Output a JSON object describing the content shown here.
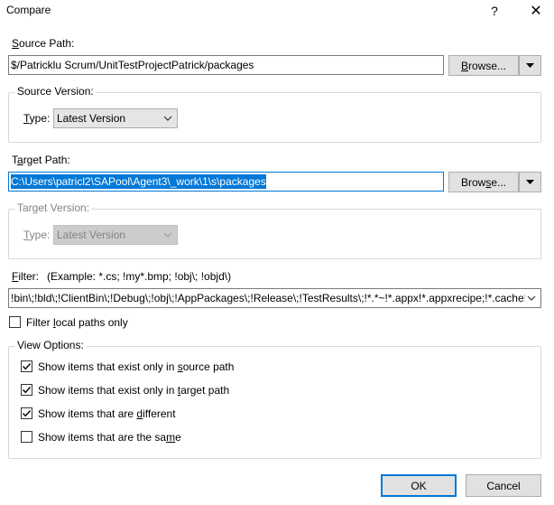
{
  "window": {
    "title": "Compare",
    "help_glyph": "?",
    "close_glyph": "✕"
  },
  "source": {
    "path_label_prefix": "",
    "path_label_mn": "S",
    "path_label_rest": "ource Path:",
    "path_value": "$/Patricklu Scrum/UnitTestProjectPatrick/packages",
    "browse_label_mn": "B",
    "browse_label_rest": "rowse..."
  },
  "source_version": {
    "group_title": "Source Version:",
    "type_label_mn": "T",
    "type_label_rest": "ype:",
    "type_value": "Latest Version"
  },
  "target": {
    "path_label_prefix": "T",
    "path_label_mn": "a",
    "path_label_rest": "rget Path:",
    "path_value": "C:\\Users\\patricl2\\SAPool\\Agent3\\_work\\1\\s\\packages",
    "browse_label_prefix": "Brow",
    "browse_label_mn": "s",
    "browse_label_rest": "e..."
  },
  "target_version": {
    "group_title": "Target Version:",
    "type_label_mn": "T",
    "type_label_rest": "ype:",
    "type_value": "Latest Version"
  },
  "filter": {
    "label_mn": "F",
    "label_rest": "ilter:",
    "example": "(Example: *.cs; !my*.bmp; !obj\\; !objd\\)",
    "value": "!bin\\;!bld\\;!ClientBin\\;!Debug\\;!obj\\;!AppPackages\\;!Release\\;!TestResults\\;!*.*~!*.appx!*.appxrecipe;!*.cache!",
    "local_only_prefix": "Filter ",
    "local_only_mn": "l",
    "local_only_rest": "ocal paths only",
    "local_only_checked": false
  },
  "view_options": {
    "group_title": "View Options:",
    "items": [
      {
        "prefix": "Show items that exist only in ",
        "mn": "s",
        "rest": "ource path",
        "checked": true
      },
      {
        "prefix": "Show items that exist only in ",
        "mn": "t",
        "rest": "arget path",
        "checked": true
      },
      {
        "prefix": "Show items that are ",
        "mn": "d",
        "rest": "ifferent",
        "checked": true
      },
      {
        "prefix": "Show items that are the sa",
        "mn": "m",
        "rest": "e",
        "checked": false
      }
    ]
  },
  "footer": {
    "ok_label": "OK",
    "cancel_label": "Cancel"
  }
}
